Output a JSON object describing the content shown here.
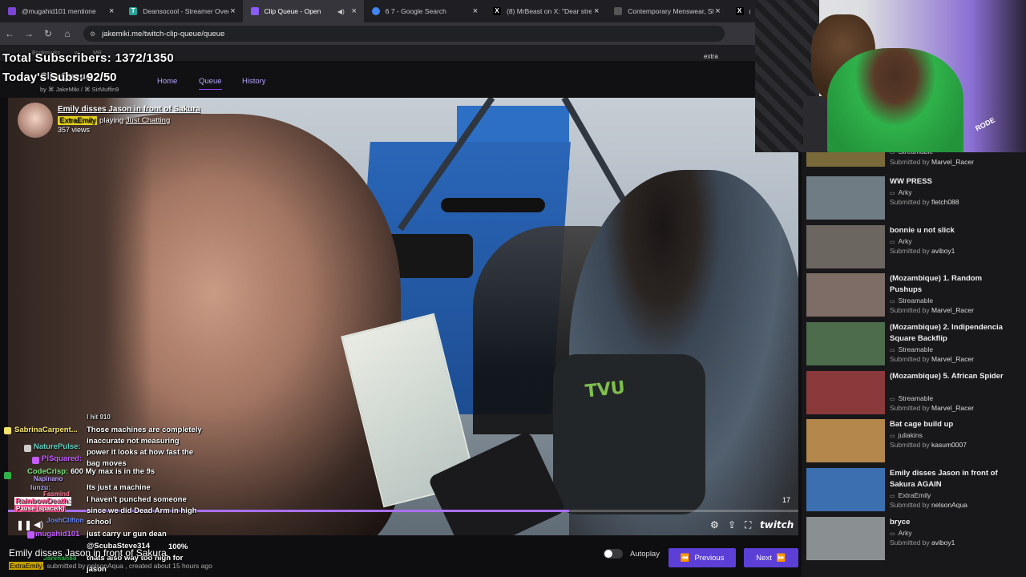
{
  "browser": {
    "tabs": [
      {
        "label": "@mugahid101 mentione",
        "fav_color": "#7b45d6",
        "active": false
      },
      {
        "label": "Deansocool - Streamer Over",
        "fav_color": "#2aa198",
        "active": false
      },
      {
        "label": "Clip Queue - Open",
        "fav_color": "#8a5cf6",
        "active": true
      },
      {
        "label": "6 7 - Google Search",
        "fav_color": "#4285f4",
        "active": false
      },
      {
        "label": "(8) MrBeast on X: \"Dear strea",
        "fav_color": "#000000",
        "active": false
      },
      {
        "label": "Contemporary Menswear, Sh",
        "fav_color": "#555555",
        "active": false
      },
      {
        "label": "(8)",
        "fav_color": "#000000",
        "active": false
      }
    ],
    "url": "jakemiki.me/twitch-clip-queue/queue",
    "bookmarks": [
      "Bookmarks",
      "w",
      "MR"
    ]
  },
  "overlay": {
    "total_subs": "Total Subscribers: 1372/1350",
    "today_subs": "Today's Subs: 92/50",
    "extra_label": "extra"
  },
  "site": {
    "brand": "Clip Queue",
    "by": "by",
    "author1": "JakeMiki",
    "author2": "SirMuffin9",
    "nav": [
      "Home",
      "Queue",
      "History"
    ]
  },
  "clip": {
    "title": "Emily disses Jason in front of Sakura",
    "channel": "ExtraEmily",
    "playing": "playing",
    "game": "Just Chatting",
    "views": "357 views",
    "progress": 0.71,
    "seconds_left": "17",
    "volume": "100%",
    "bottom_title": "Emily disses Jason in front of Sakura",
    "bottom_meta_channel": "ExtraEmily",
    "bottom_meta_rest": ", submitted by nelsonAqua , created about 15 hours ago"
  },
  "controls": {
    "autoplay": "Autoplay",
    "previous": "Previous",
    "next": "Next",
    "twitch": "twitch"
  },
  "chat": [
    {
      "name": "",
      "text": "I hit 910",
      "color": "#fff"
    },
    {
      "name": "SabrinaCarpent...",
      "text": "Those machines are completely",
      "color": "#f2e36c"
    },
    {
      "name": "",
      "text": "inaccurate not measuring",
      "color": "#fff"
    },
    {
      "name": "NaturePulse:",
      "text": "power it looks at how fast the",
      "color": "#5fd4c4"
    },
    {
      "name": "PiSquared:",
      "text": "bag moves",
      "color": "#c45cff"
    },
    {
      "name": "CodeCrisp:",
      "text": "600  My max is in the 9s",
      "color": "#7ee37e"
    },
    {
      "name": "Napinano",
      "text": "",
      "color": "#b59cff"
    },
    {
      "name": "lunzu:",
      "text": "Its just a machine",
      "color": "#a4a4ff"
    },
    {
      "name": "Fasmind",
      "text": "",
      "color": "#ff7b9c"
    },
    {
      "name": "RainbowDeath:",
      "text": "I haven't punched someone",
      "color": "#ff4c8c"
    },
    {
      "name": "",
      "text": "since we did Dead Arm in high",
      "color": "#fff"
    },
    {
      "name": "JoshClifton",
      "text": "school",
      "color": "#6a8cff"
    },
    {
      "name": "mugahid101",
      "text": "just carry ur gun dean",
      "color": "#c05cff"
    },
    {
      "name": "",
      "text": "@ScubaSteve314",
      "color": "#fff"
    },
    {
      "name": "Janman88",
      "text": "thats also way too high for",
      "color": "#2fb24a"
    },
    {
      "name": "",
      "text": "jason",
      "color": "#fff"
    }
  ],
  "chat_tooltip": "Pause (space/k)",
  "webcam": {
    "mic_brand": "RODE"
  },
  "queue": [
    {
      "title": "",
      "channel": "Streamable",
      "submitter": "Marvel_Racer",
      "thumb": "#7a6a3a"
    },
    {
      "title": "WW PRESS",
      "channel": "Arky",
      "submitter": "fletch088",
      "thumb": "#6f7c84"
    },
    {
      "title": "bonnie u not slick",
      "channel": "Arky",
      "submitter": "aviboy1",
      "thumb": "#6c6660"
    },
    {
      "title": "(Mozambique) 1. Random Pushups",
      "channel": "Streamable",
      "submitter": "Marvel_Racer",
      "thumb": "#7e6d66"
    },
    {
      "title": "(Mozambique) 2. Indipendencia Square Backflip",
      "channel": "Streamable",
      "submitter": "Marvel_Racer",
      "thumb": "#4c6c4c"
    },
    {
      "title": "(Mozambique) 5. African Spider",
      "channel": "Streamable",
      "submitter": "Marvel_Racer",
      "thumb": "#8a3a3a"
    },
    {
      "title": "Bat cage build up",
      "channel": "juliakins",
      "submitter": "kasum0007",
      "thumb": "#b4874d"
    },
    {
      "title": "Emily disses Jason in front of Sakura AGAIN",
      "channel": "ExtraEmily",
      "submitter": "nelsonAqua",
      "thumb": "#3b6fb0"
    },
    {
      "title": "bryce",
      "channel": "Arky",
      "submitter": "aviboy1",
      "thumb": "#8a8f92"
    }
  ],
  "labels": {
    "submitted_by": "Submitted by"
  },
  "colors": {
    "accent": "#9147ff",
    "button": "#5c3fd6",
    "bg": "#0e0e10"
  }
}
